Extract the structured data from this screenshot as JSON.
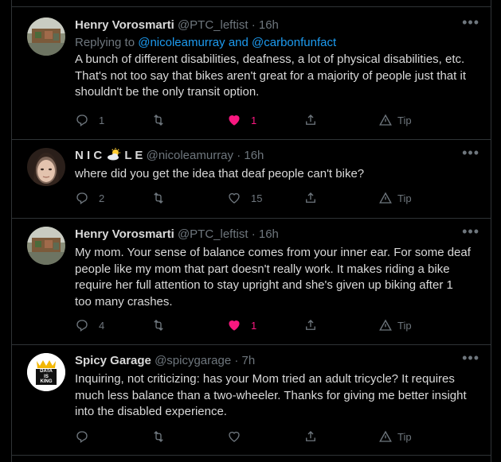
{
  "tweets": [
    {
      "name": "Henry Vorosmarti",
      "handle": "@PTC_leftist",
      "time": "16h",
      "replying_prefix": "Replying to ",
      "replying_links": "@nicoleamurray and @carbonfunfact",
      "text_lines": [
        "A bunch of different disabilities, deafness, a lot of physical disabilities, etc.",
        "That's not too say that bikes aren't great for a majority of people just that it",
        "shouldn't be the only transit option."
      ],
      "replies": "1",
      "retweets": "",
      "likes": "1",
      "liked": true,
      "tip_label": "Tip"
    },
    {
      "name_part1": "N I C",
      "name_part2": "L E",
      "handle": "@nicoleamurray",
      "time": "16h",
      "text_lines": [
        "where did you get the idea that deaf people can't bike?"
      ],
      "replies": "2",
      "retweets": "",
      "likes": "15",
      "liked": false,
      "tip_label": "Tip"
    },
    {
      "name": "Henry Vorosmarti",
      "handle": "@PTC_leftist",
      "time": "16h",
      "text_lines": [
        "My mom. Your sense of balance comes from your inner ear. For some deaf",
        "people like my mom that part doesn't really work. It makes riding a bike",
        "require her full attention to stay upright and she's given up biking after 1",
        "too many crashes."
      ],
      "replies": "4",
      "retweets": "",
      "likes": "1",
      "liked": true,
      "tip_label": "Tip"
    },
    {
      "name": "Spicy Garage",
      "handle": "@spicygarage",
      "time": "7h",
      "avatar_text": "DATA IS KING",
      "text_lines": [
        "Inquiring, not criticizing: has your Mom tried an adult tricycle? It requires",
        "much less balance than a two-wheeler. Thanks for giving me better insight",
        "into the disabled experience."
      ],
      "replies": "",
      "retweets": "",
      "likes": "",
      "liked": false,
      "tip_label": "Tip"
    }
  ],
  "colors": {
    "bg": "#000000",
    "text": "#d9d9d9",
    "muted": "#6e767d",
    "link": "#1d9bf0",
    "like": "#f91880",
    "border": "#2f3336"
  },
  "icons": [
    "reply-icon",
    "retweet-icon",
    "heart-icon",
    "share-icon",
    "tip-icon",
    "more-icon",
    "sun-cloud-icon"
  ]
}
